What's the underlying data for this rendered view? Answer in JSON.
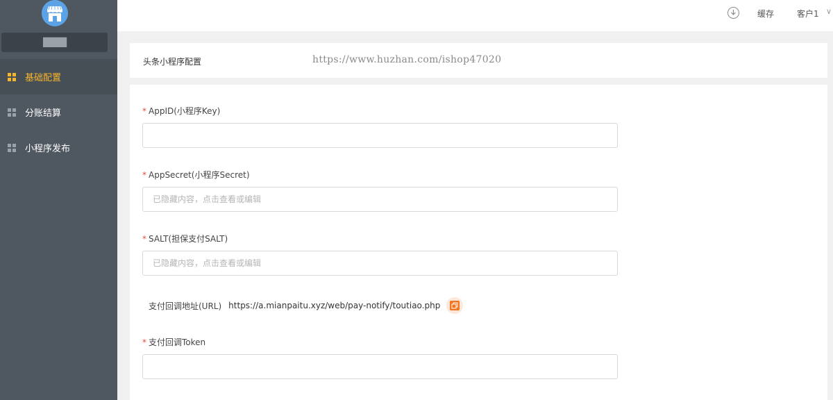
{
  "sidebar": {
    "store_name": "████",
    "items": [
      {
        "label": "基础配置",
        "icon": "grid-icon",
        "active": true
      },
      {
        "label": "分账结算",
        "icon": "grid-icon",
        "active": false
      },
      {
        "label": "小程序发布",
        "icon": "grid-icon",
        "active": false
      }
    ]
  },
  "topbar": {
    "download_icon": "download-icon",
    "cache_label": "缓存",
    "user_label": "客户1",
    "caret": "∨"
  },
  "header": {
    "title": "头条小程序配置",
    "watermark": "https://www.huzhan.com/ishop47020"
  },
  "form": {
    "appid": {
      "label": "AppID(小程序Key)",
      "value": "",
      "placeholder": ""
    },
    "appsecret": {
      "label": "AppSecret(小程序Secret)",
      "value": "",
      "placeholder": "已隐藏内容，点击查看或编辑"
    },
    "salt": {
      "label": "SALT(担保支付SALT)",
      "value": "",
      "placeholder": "已隐藏内容，点击查看或编辑"
    },
    "notify": {
      "label": "支付回调地址(URL)",
      "url": "https://a.mianpaitu.xyz/web/pay-notify/toutiao.php",
      "copy_icon": "copy-icon"
    },
    "token": {
      "label": "支付回调Token",
      "value": "",
      "placeholder": ""
    }
  },
  "colors": {
    "sidebar_bg": "#4f5760",
    "accent": "#f7b52c",
    "required": "#e94b3b",
    "copy_accent": "#f0761f"
  }
}
